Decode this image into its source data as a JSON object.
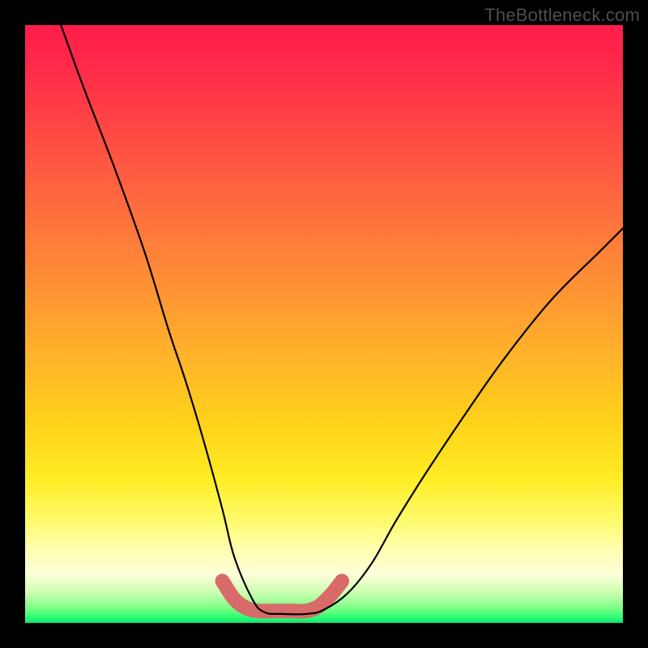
{
  "watermark": "TheBottleneck.com",
  "chart_data": {
    "type": "line",
    "title": "",
    "xlabel": "",
    "ylabel": "",
    "xlim": [
      0,
      100
    ],
    "ylim": [
      0,
      100
    ],
    "grid": false,
    "legend": false,
    "series": [
      {
        "name": "main-curve",
        "color": "#000000",
        "x": [
          6,
          10,
          15,
          20,
          24,
          27,
          30,
          33,
          35,
          38,
          40,
          43,
          47,
          50,
          54,
          58,
          62,
          67,
          73,
          80,
          88,
          96,
          100
        ],
        "y": [
          100,
          89,
          76,
          62,
          49,
          40,
          30,
          19,
          11,
          4,
          1.8,
          1.5,
          1.5,
          2.2,
          5,
          10,
          17,
          25,
          34,
          44,
          54,
          62,
          66
        ]
      },
      {
        "name": "bottom-marker-band",
        "color": "#d96a6a",
        "x": [
          33,
          35,
          37,
          39,
          41,
          43,
          45,
          47,
          49,
          51,
          53
        ],
        "y": [
          7,
          4,
          2.5,
          2,
          2,
          2,
          2,
          2,
          2.7,
          4.5,
          7
        ]
      }
    ],
    "gradient_stops": [
      {
        "pos": 0.0,
        "color": "#ff1c49"
      },
      {
        "pos": 0.3,
        "color": "#ff6b3e"
      },
      {
        "pos": 0.55,
        "color": "#ffb22a"
      },
      {
        "pos": 0.76,
        "color": "#ffed25"
      },
      {
        "pos": 0.88,
        "color": "#ffffb5"
      },
      {
        "pos": 0.97,
        "color": "#7fff86"
      },
      {
        "pos": 1.0,
        "color": "#11e66d"
      }
    ]
  }
}
